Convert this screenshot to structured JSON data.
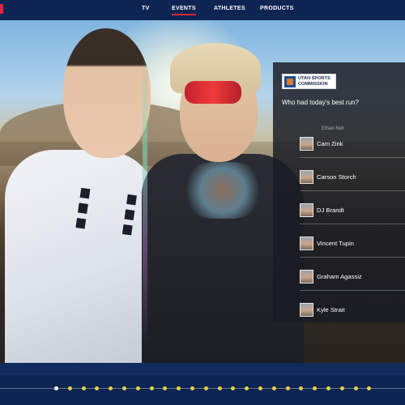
{
  "nav": {
    "items": [
      {
        "label": "TV",
        "active": false
      },
      {
        "label": "EVENTS",
        "active": true
      },
      {
        "label": "ATHLETES",
        "active": false
      },
      {
        "label": "PRODUCTS",
        "active": false
      }
    ],
    "accent_color": "#e3263b",
    "background": "#0e2553"
  },
  "poll": {
    "sponsor_text": "UTAH SPORTS COMMISSION",
    "question": "Who had today's best run?",
    "partial_name": "Ethan Nell",
    "options": [
      {
        "label": "Cam Zink"
      },
      {
        "label": "Carson Storch"
      },
      {
        "label": "DJ Brandt"
      },
      {
        "label": "Vincent Tupin"
      },
      {
        "label": "Graham Agassiz"
      },
      {
        "label": "Kyle Strait"
      }
    ]
  },
  "timeline": {
    "marker_count": 24,
    "current_index": 0,
    "marker_color": "#e6d147",
    "current_color": "#ffffff"
  }
}
